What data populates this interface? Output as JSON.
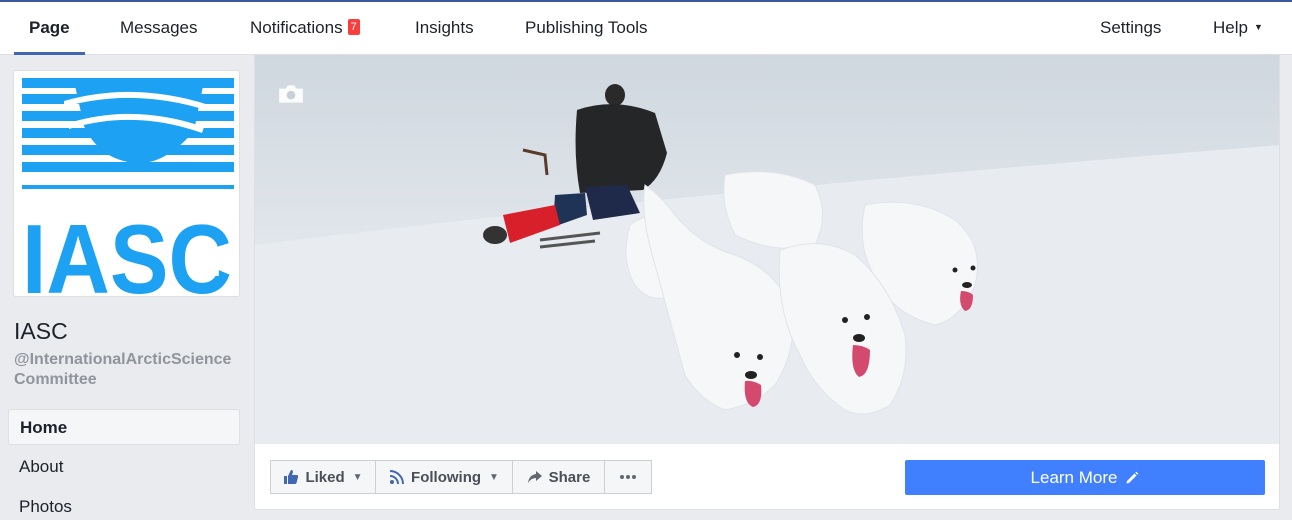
{
  "topnav": {
    "tabs": [
      {
        "label": "Page"
      },
      {
        "label": "Messages"
      },
      {
        "label": "Notifications",
        "badge": "7"
      },
      {
        "label": "Insights"
      },
      {
        "label": "Publishing Tools"
      }
    ],
    "settings_label": "Settings",
    "help_label": "Help"
  },
  "profile": {
    "logo_text": "IASC",
    "name": "IASC",
    "handle": "@InternationalArcticScienceCommittee"
  },
  "sidebar": {
    "items": [
      {
        "label": "Home"
      },
      {
        "label": "About"
      },
      {
        "label": "Photos"
      }
    ]
  },
  "actions": {
    "liked_label": "Liked",
    "following_label": "Following",
    "share_label": "Share",
    "learn_more_label": "Learn More"
  },
  "colors": {
    "brand": "#3b5998",
    "accent_button": "#4080ff",
    "badge": "#fa3e3e",
    "logo_blue": "#1da1f2"
  },
  "icons": [
    "camera-icon",
    "thumbs-up-icon",
    "rss-icon",
    "share-arrow-icon",
    "more-icon",
    "pencil-icon",
    "caret-down-icon"
  ]
}
